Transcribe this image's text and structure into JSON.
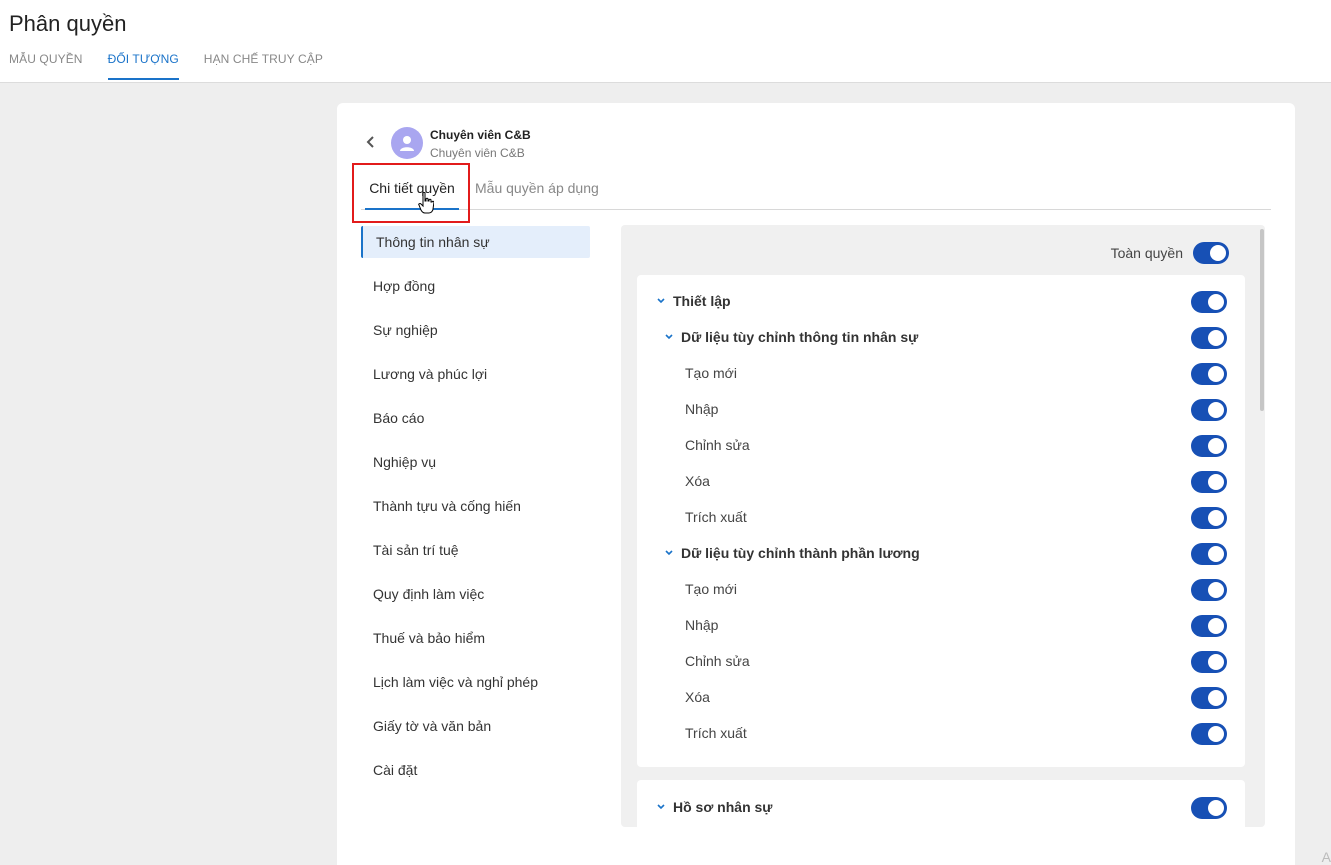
{
  "page": {
    "title": "Phân quyền"
  },
  "top_tabs": [
    {
      "label": "MẪU QUYỀN",
      "active": false
    },
    {
      "label": "ĐỐI TƯỢNG",
      "active": true
    },
    {
      "label": "HẠN CHẾ TRUY CẬP",
      "active": false
    }
  ],
  "user": {
    "name": "Chuyên viên C&B",
    "role": "Chuyên viên C&B"
  },
  "detail_tabs": {
    "active": "Chi tiết quyền",
    "inactive": "Mẫu quyền áp dụng"
  },
  "left_menu": [
    "Thông tin nhân sự",
    "Hợp đồng",
    "Sự nghiệp",
    "Lương và phúc lợi",
    "Báo cáo",
    "Nghiệp vụ",
    "Thành tựu và cống hiến",
    "Tài sản trí tuệ",
    "Quy định làm việc",
    "Thuế và bảo hiểm",
    "Lịch làm việc và nghỉ phép",
    "Giấy tờ và văn bản",
    "Cài đặt"
  ],
  "permissions": {
    "full_label": "Toàn quyền",
    "full_enabled": true,
    "group1": {
      "label": "Thiết lập",
      "enabled": true,
      "sub1": {
        "label": "Dữ liệu tùy chỉnh thông tin nhân sự",
        "enabled": true,
        "items": [
          "Tạo mới",
          "Nhập",
          "Chỉnh sửa",
          "Xóa",
          "Trích xuất"
        ]
      },
      "sub2": {
        "label": "Dữ liệu tùy chỉnh thành phần lương",
        "enabled": true,
        "items": [
          "Tạo mới",
          "Nhập",
          "Chỉnh sửa",
          "Xóa",
          "Trích xuất"
        ]
      }
    },
    "group2": {
      "label": "Hồ sơ nhân sự",
      "enabled": true
    }
  },
  "accent_color": "#1a73c9",
  "toggle_color": "#1750b5",
  "highlight_color": "#e21b1b",
  "corner_text": "A"
}
